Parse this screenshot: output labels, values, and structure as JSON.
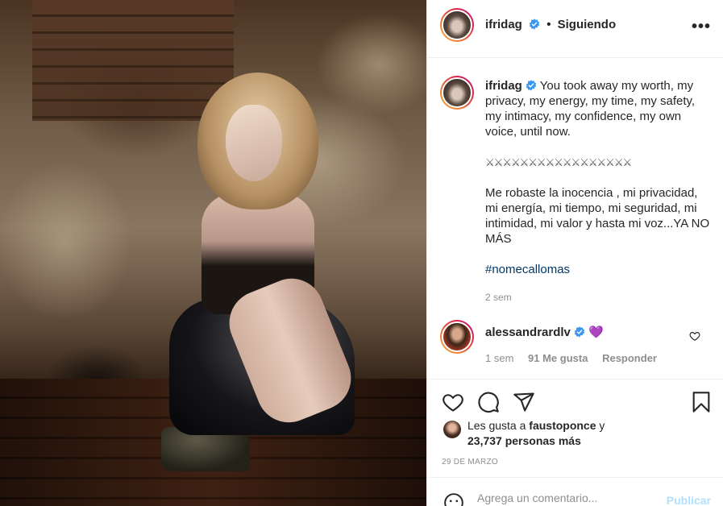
{
  "post": {
    "image_alt": "Woman with blonde wavy hair crouching in black leather pants against a weathered brick wall"
  },
  "header": {
    "username": "ifridag",
    "separator": "•",
    "follow_status": "Siguiendo",
    "more_label": "•••"
  },
  "caption": {
    "username": "ifridag",
    "english": "You took away my worth, my privacy, my energy, my time, my safety, my intimacy, my confidence, my own voice, until now.",
    "divider": "⚔⚔⚔⚔⚔⚔⚔⚔⚔⚔⚔⚔⚔⚔⚔⚔⚔",
    "spanish": "Me robaste la inocencia , mi privacidad, mi energía, mi tiempo, mi seguridad, mi intimidad, mi valor y hasta mi voz...YA NO MÁS",
    "hashtag": "#nomecallomas",
    "time": "2 sem"
  },
  "comment": {
    "username": "alessandrardlv",
    "text": "💜",
    "time": "1 sem",
    "likes": "91 Me gusta",
    "reply": "Responder"
  },
  "likes": {
    "prefix": "Les gusta a",
    "user": "faustoponce",
    "and": "y",
    "others": "23,737 personas más"
  },
  "date": "29 DE MARZO",
  "add_comment": {
    "placeholder": "Agrega un comentario...",
    "post_label": "Publicar"
  },
  "colors": {
    "verified": "#3897f0",
    "link": "#00376b",
    "secondary": "#8e8e8e",
    "post_disabled": "#b2dffc"
  }
}
